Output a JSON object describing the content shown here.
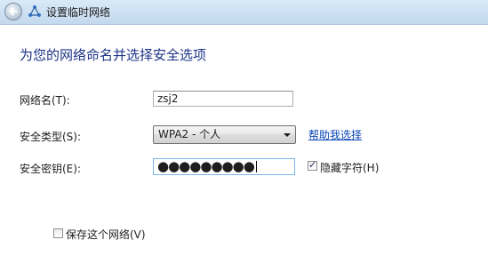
{
  "window": {
    "title": "设置临时网络"
  },
  "icons": {
    "back": "back-arrow-icon",
    "network": "network-icon",
    "dropdown": "chevron-down-icon",
    "check": "checkmark-icon"
  },
  "form": {
    "heading": "为您的网络命名并选择安全选项",
    "network_name_label": "网络名(T):",
    "network_name_value": "zsj2",
    "security_type_label": "安全类型(S):",
    "security_type_value": "WPA2 - 个人",
    "help_link": "帮助我选择",
    "security_key_label": "安全密钥(E):",
    "security_key_value": "●●●●●●●●●",
    "hide_chars_label": "隐藏字符(H)",
    "hide_chars_checked": true,
    "save_network_label": "保存这个网络(V)",
    "save_network_checked": false
  },
  "colors": {
    "heading": "#1c3387",
    "link": "#0a46b5",
    "titlebar": "#c3d9ee",
    "focus_border": "#7eb4ea"
  }
}
